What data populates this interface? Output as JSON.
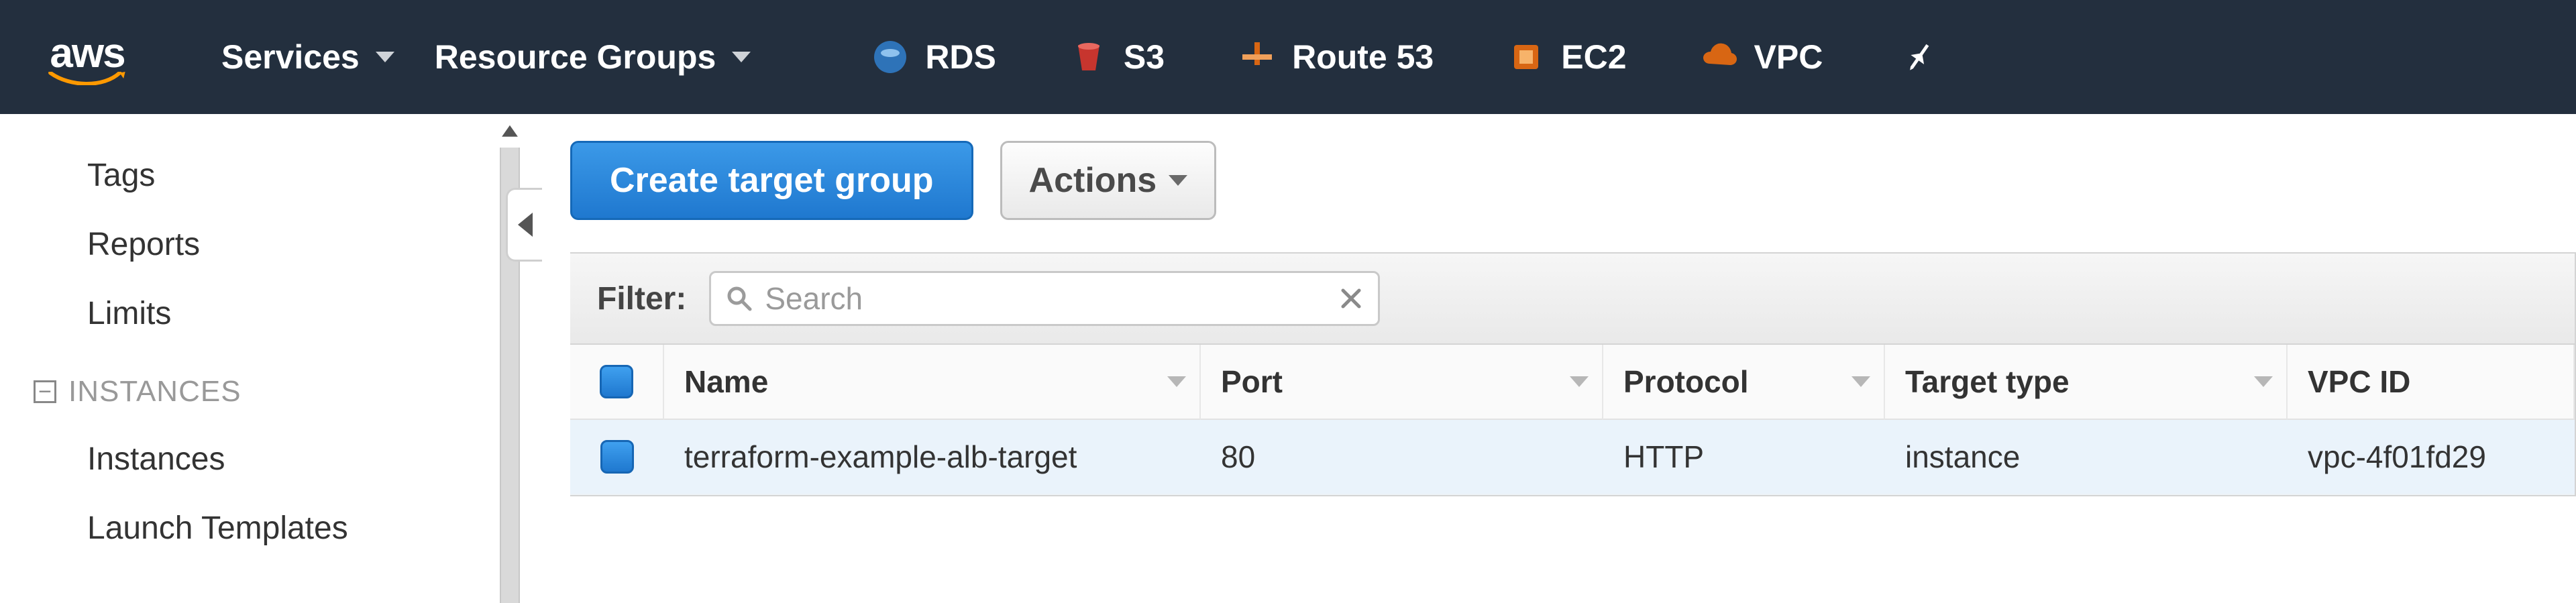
{
  "nav": {
    "services_label": "Services",
    "resource_groups_label": "Resource Groups",
    "shortcuts": [
      {
        "label": "RDS",
        "icon": "rds-icon",
        "color": "#2e73b8"
      },
      {
        "label": "S3",
        "icon": "s3-icon",
        "color": "#c7352e"
      },
      {
        "label": "Route 53",
        "icon": "route53-icon",
        "color": "#d86613"
      },
      {
        "label": "EC2",
        "icon": "ec2-icon",
        "color": "#d86613"
      },
      {
        "label": "VPC",
        "icon": "vpc-icon",
        "color": "#d86613"
      }
    ]
  },
  "sidebar": {
    "items_top": [
      {
        "label": "Tags"
      },
      {
        "label": "Reports"
      },
      {
        "label": "Limits"
      }
    ],
    "section_label": "INSTANCES",
    "items_section": [
      {
        "label": "Instances"
      },
      {
        "label": "Launch Templates"
      }
    ]
  },
  "toolbar": {
    "create_label": "Create target group",
    "actions_label": "Actions"
  },
  "filter": {
    "label": "Filter:",
    "placeholder": "Search"
  },
  "table": {
    "columns": {
      "name": "Name",
      "port": "Port",
      "protocol": "Protocol",
      "target_type": "Target type",
      "vpc_id": "VPC ID"
    },
    "rows": [
      {
        "name": "terraform-example-alb-target",
        "port": "80",
        "protocol": "HTTP",
        "target_type": "instance",
        "vpc_id": "vpc-4f01fd29"
      }
    ]
  }
}
